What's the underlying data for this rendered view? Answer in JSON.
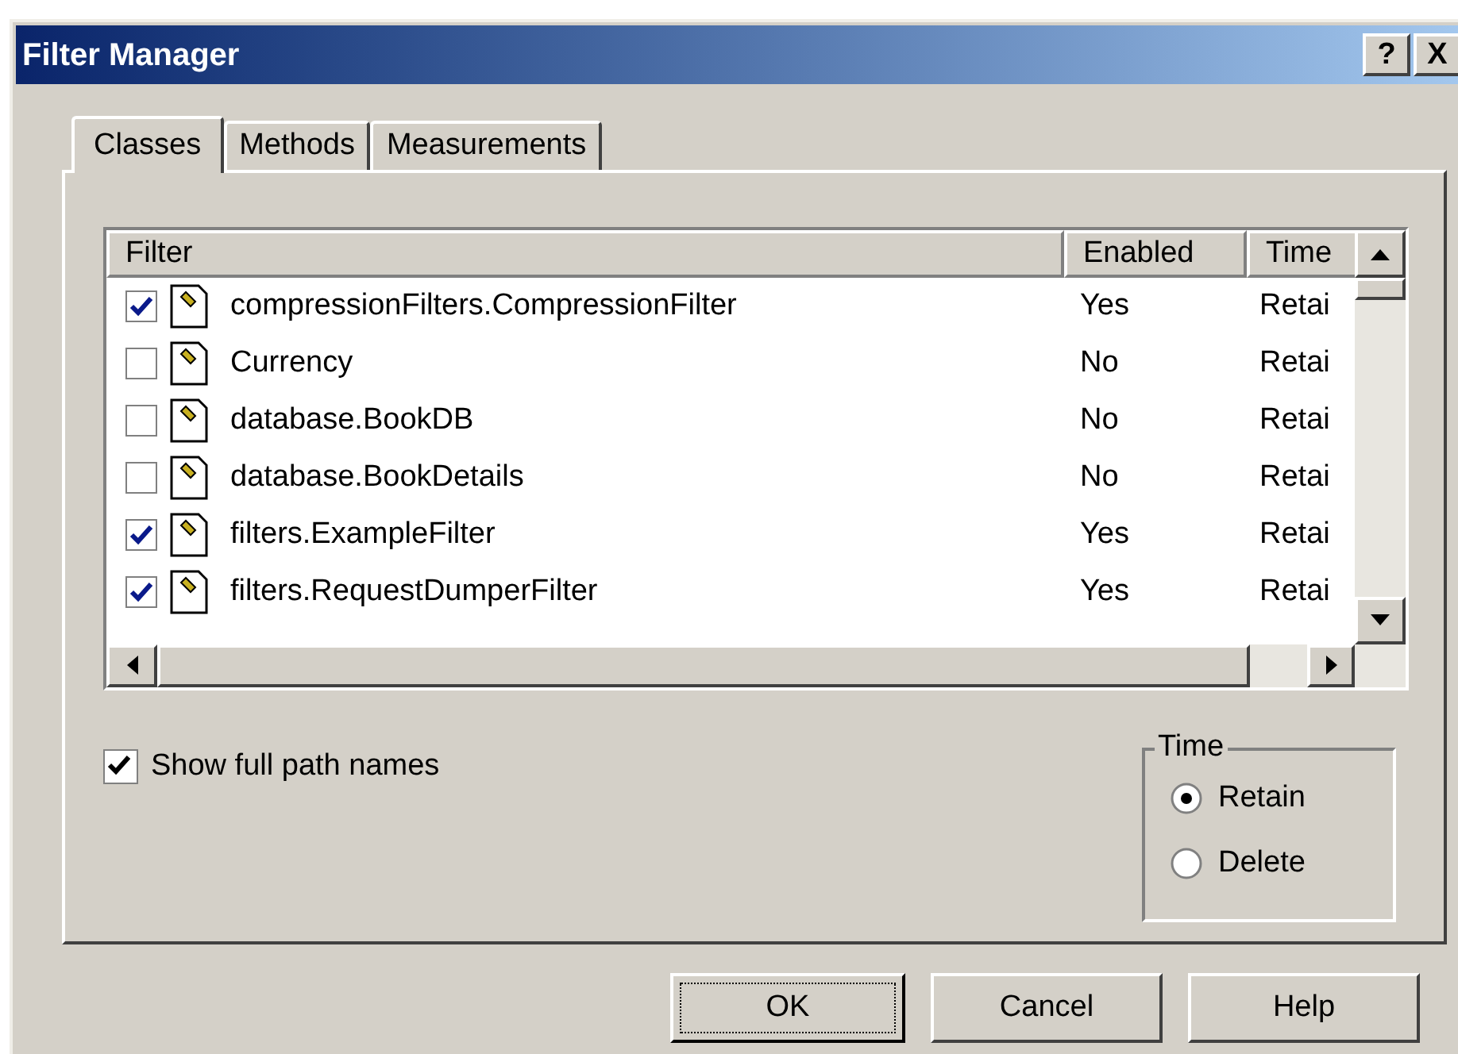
{
  "window": {
    "title": "Filter Manager",
    "buttons": [
      "?",
      "X"
    ]
  },
  "tabs": [
    {
      "label": "Classes",
      "selected": true
    },
    {
      "label": "Methods",
      "selected": false
    },
    {
      "label": "Measurements",
      "selected": false
    }
  ],
  "table": {
    "columns": [
      "Filter",
      "Enabled",
      "Time"
    ],
    "rows": [
      {
        "checked": true,
        "filter": "compressionFilters.CompressionFilter",
        "enabled": "Yes",
        "time": "Retai"
      },
      {
        "checked": false,
        "filter": "Currency",
        "enabled": "No",
        "time": "Retai"
      },
      {
        "checked": false,
        "filter": "database.BookDB",
        "enabled": "No",
        "time": "Retai"
      },
      {
        "checked": false,
        "filter": "database.BookDetails",
        "enabled": "No",
        "time": "Retai"
      },
      {
        "checked": true,
        "filter": "filters.ExampleFilter",
        "enabled": "Yes",
        "time": "Retai"
      },
      {
        "checked": true,
        "filter": "filters.RequestDumperFilter",
        "enabled": "Yes",
        "time": "Retai"
      }
    ]
  },
  "show_full_path": {
    "label": "Show full path names",
    "checked": true
  },
  "time_group": {
    "title": "Time",
    "options": [
      {
        "label": "Retain",
        "selected": true
      },
      {
        "label": "Delete",
        "selected": false
      }
    ]
  },
  "buttons": [
    {
      "label": "OK",
      "default": true
    },
    {
      "label": "Cancel",
      "default": false
    },
    {
      "label": "Help",
      "default": false
    }
  ]
}
